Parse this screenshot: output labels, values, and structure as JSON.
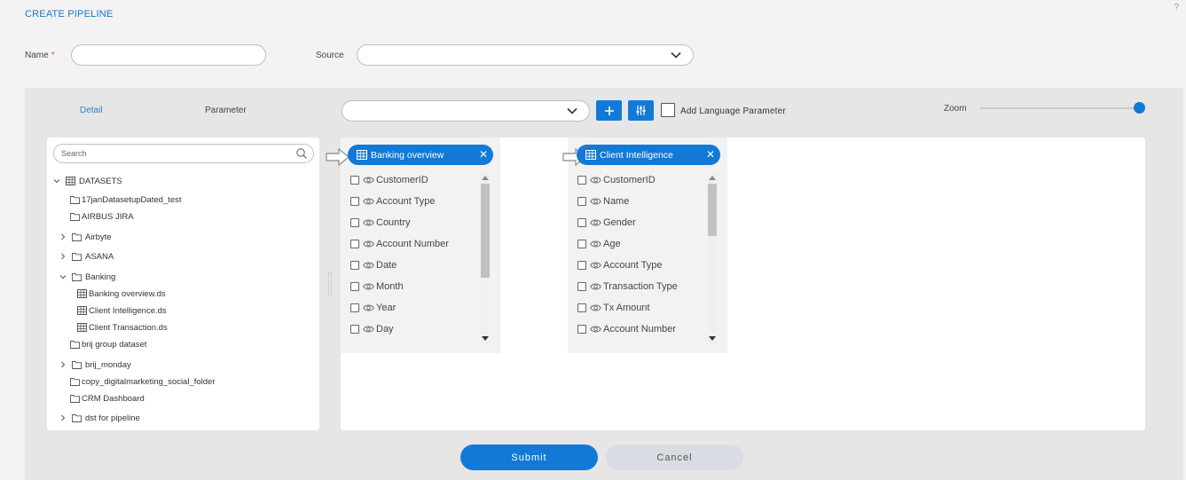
{
  "header": {
    "title": "CREATE PIPELINE",
    "help": "?"
  },
  "form": {
    "name_label": "Name",
    "required_mark": "*",
    "name_value": "",
    "source_label": "Source",
    "source_value": ""
  },
  "tabs": [
    {
      "label": "Detail",
      "active": true
    },
    {
      "label": "Parameter",
      "active": false
    }
  ],
  "toolbar": {
    "parameter_select_value": "",
    "add_icon": "plus-icon",
    "settings_icon": "sliders-icon",
    "language_checkbox_label": "Add Language Parameter",
    "zoom_label": "Zoom",
    "zoom_level": 1.0
  },
  "tree": {
    "search_placeholder": "Search",
    "root": "DATASETS",
    "items": [
      {
        "label": "17janDatasetupDated_test",
        "type": "folder",
        "expand": "none"
      },
      {
        "label": "AIRBUS JIRA",
        "type": "folder",
        "expand": "none"
      },
      {
        "label": "Airbyte",
        "type": "folder",
        "expand": "collapsed"
      },
      {
        "label": "ASANA",
        "type": "folder",
        "expand": "collapsed"
      },
      {
        "label": "Banking",
        "type": "folder",
        "expand": "expanded"
      },
      {
        "label": "Banking overview.ds",
        "type": "dataset",
        "expand": "none"
      },
      {
        "label": "Client Intelligence.ds",
        "type": "dataset",
        "expand": "none"
      },
      {
        "label": "Client Transaction.ds",
        "type": "dataset",
        "expand": "none"
      },
      {
        "label": "brij group dataset",
        "type": "folder",
        "expand": "none"
      },
      {
        "label": "brij_monday",
        "type": "folder",
        "expand": "collapsed"
      },
      {
        "label": "copy_digitalmarketing_social_folder",
        "type": "folder",
        "expand": "none"
      },
      {
        "label": "CRM Dashboard",
        "type": "folder",
        "expand": "none"
      },
      {
        "label": "dst for pipeline",
        "type": "folder",
        "expand": "collapsed"
      }
    ]
  },
  "datasets": [
    {
      "title": "Banking overview",
      "fields": [
        "CustomerID",
        "Account Type",
        "Country",
        "Account Number",
        "Date",
        "Month",
        "Year",
        "Day"
      ]
    },
    {
      "title": "Client Intelligence",
      "fields": [
        "CustomerID",
        "Name",
        "Gender",
        "Age",
        "Account Type",
        "Transaction Type",
        "Tx Amount",
        "Account Number"
      ]
    }
  ],
  "actions": {
    "submit": "Submit",
    "cancel": "Cancel"
  },
  "colors": {
    "primary": "#1379d6",
    "link": "#1b75c9",
    "panel": "#e6e6e6",
    "cancel_bg": "#d9dde3"
  }
}
